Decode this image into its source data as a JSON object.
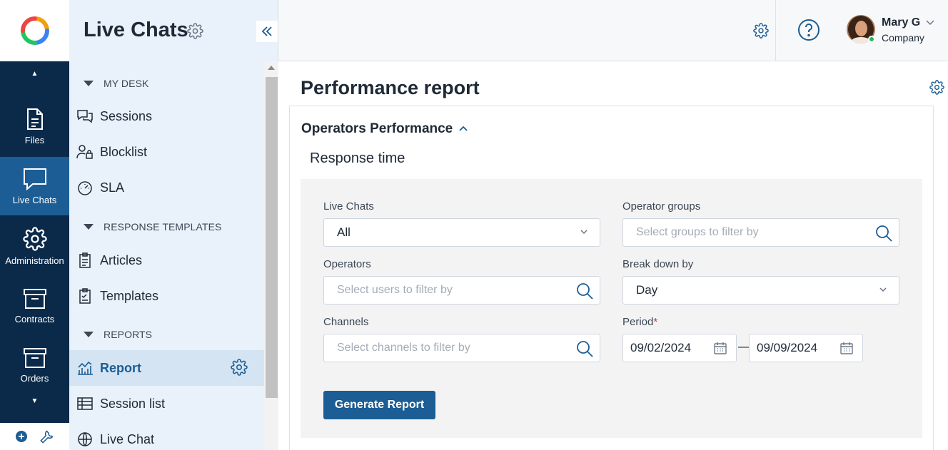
{
  "rail": {
    "items": [
      {
        "label": "Files",
        "icon": "file-icon"
      },
      {
        "label": "Live Chats",
        "icon": "chat-bubble-icon",
        "active": true
      },
      {
        "label": "Administration",
        "icon": "gear-icon"
      },
      {
        "label": "Contracts",
        "icon": "archive-box-icon"
      },
      {
        "label": "Orders",
        "icon": "archive-box-icon"
      }
    ]
  },
  "sidebar": {
    "title": "Live Chats",
    "sections": [
      {
        "label": "MY DESK"
      },
      {
        "label": "RESPONSE TEMPLATES"
      },
      {
        "label": "REPORTS"
      }
    ],
    "items": [
      {
        "label": "Sessions",
        "icon": "chat-bubbles-icon"
      },
      {
        "label": "Blocklist",
        "icon": "user-lock-icon"
      },
      {
        "label": "SLA",
        "icon": "gauge-icon"
      },
      {
        "label": "Articles",
        "icon": "clipboard-icon"
      },
      {
        "label": "Templates",
        "icon": "clipboard-check-icon"
      },
      {
        "label": "Report",
        "icon": "chart-icon",
        "active": true
      },
      {
        "label": "Session list",
        "icon": "table-icon"
      },
      {
        "label": "Live Chat",
        "icon": "globe-chat-icon"
      }
    ]
  },
  "header": {
    "user_name": "Mary G",
    "user_company": "Company",
    "status": "online"
  },
  "main": {
    "title": "Performance report",
    "panel_title": "Operators Performance",
    "panel_subtitle": "Response time",
    "filters": {
      "live_chats": {
        "label": "Live Chats",
        "value": "All"
      },
      "operator_groups": {
        "label": "Operator groups",
        "placeholder": "Select groups to filter by"
      },
      "operators": {
        "label": "Operators",
        "placeholder": "Select users to filter by"
      },
      "break_down": {
        "label": "Break down by",
        "value": "Day"
      },
      "channels": {
        "label": "Channels",
        "placeholder": "Select channels to filter by"
      },
      "period": {
        "label": "Period",
        "required_mark": "*",
        "from": "09/02/2024",
        "separator": "—",
        "to": "09/09/2024"
      }
    },
    "generate_label": "Generate Report"
  },
  "colors": {
    "rail_bg": "#0b2a4a",
    "accent": "#1b5d94",
    "sidebar_bg": "#e9f1fa",
    "online": "#2bb35c"
  }
}
